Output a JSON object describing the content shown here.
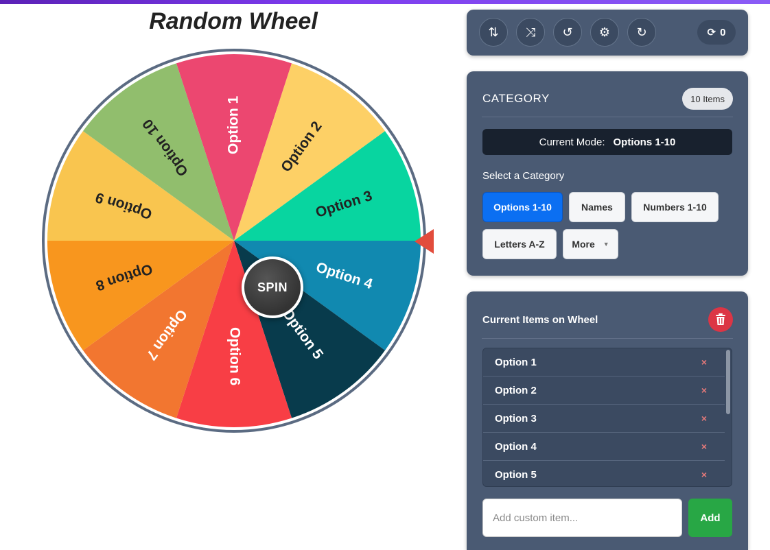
{
  "title": "Random Wheel",
  "wheel": {
    "spin_label": "SPIN",
    "segments": [
      {
        "label": "Option 1",
        "color": "#ec4770"
      },
      {
        "label": "Option 2",
        "color": "#fdd066"
      },
      {
        "label": "Option 3",
        "color": "#08d5a0"
      },
      {
        "label": "Option 4",
        "color": "#1189b0"
      },
      {
        "label": "Option 5",
        "color": "#083b4c"
      },
      {
        "label": "Option 6",
        "color": "#f83e45"
      },
      {
        "label": "Option 7",
        "color": "#f27630"
      },
      {
        "label": "Option 8",
        "color": "#f8961e"
      },
      {
        "label": "Option 9",
        "color": "#f9c54f"
      },
      {
        "label": "Option 10",
        "color": "#91be6d"
      }
    ],
    "rim_color": "#5b6b82",
    "pointer_color": "#e24c3c"
  },
  "toolbar": {
    "buttons": [
      {
        "name": "sort-az-icon",
        "glyph": "⇅"
      },
      {
        "name": "shuffle-icon",
        "glyph": "⤨"
      },
      {
        "name": "history-icon",
        "glyph": "↺"
      },
      {
        "name": "gear-icon",
        "glyph": "⚙"
      },
      {
        "name": "redo-icon",
        "glyph": "↻"
      }
    ],
    "spin_count": "0"
  },
  "category": {
    "title": "CATEGORY",
    "items_badge": "10 Items",
    "mode_label": "Current Mode:",
    "mode_value": "Options 1-10",
    "select_label": "Select a Category",
    "buttons": [
      "Options 1-10",
      "Names",
      "Numbers 1-10",
      "Letters A-Z",
      "More"
    ],
    "active": "Options 1-10"
  },
  "items_panel": {
    "title": "Current Items on Wheel",
    "items": [
      "Option 1",
      "Option 2",
      "Option 3",
      "Option 4",
      "Option 5"
    ],
    "remove_glyph": "×",
    "input_placeholder": "Add custom item...",
    "add_label": "Add"
  }
}
